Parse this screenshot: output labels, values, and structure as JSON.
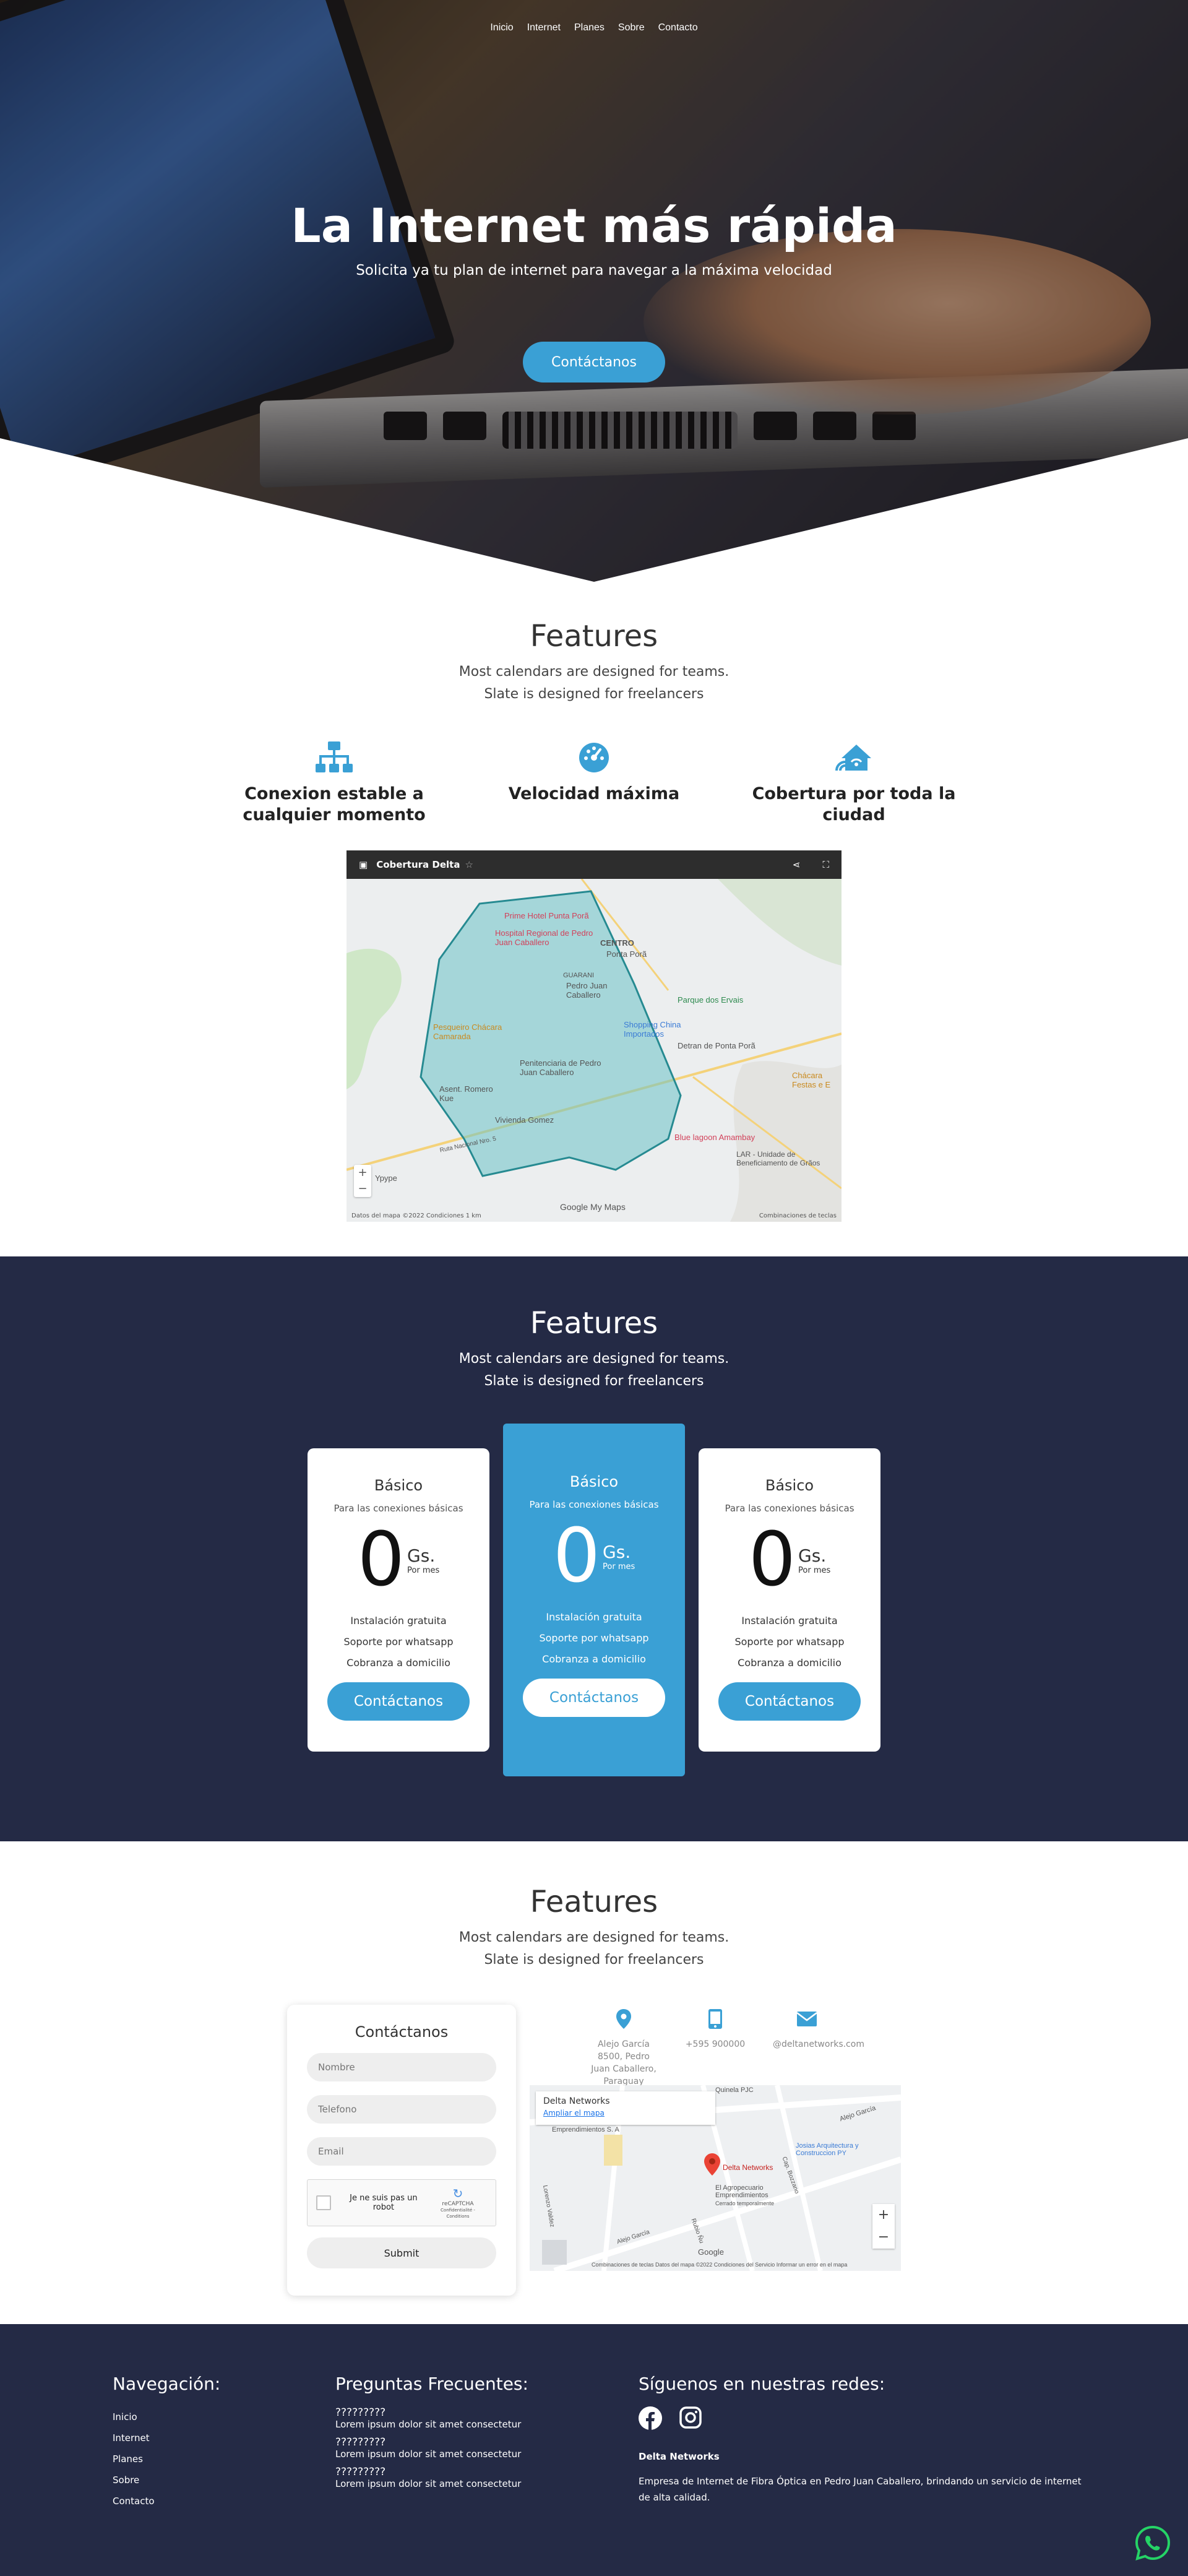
{
  "nav": {
    "items": [
      "Inicio",
      "Internet",
      "Planes",
      "Sobre",
      "Contacto"
    ]
  },
  "hero": {
    "title": "La Internet más rápida",
    "subtitle": "Solicita ya tu plan de internet para navegar a la máxima velocidad",
    "cta": "Contáctanos"
  },
  "features": {
    "title": "Features",
    "line1": "Most calendars are designed for teams.",
    "line2": "Slate is designed for freelancers",
    "items": [
      {
        "icon": "network-icon",
        "label": "Conexion estable a cualquier momento"
      },
      {
        "icon": "speedometer-icon",
        "label": "Velocidad máxima"
      },
      {
        "icon": "home-wifi-icon",
        "label": "Cobertura por toda la ciudad"
      }
    ],
    "map": {
      "title": "Cobertura Delta",
      "labels": [
        "Prime Hotel Punta Porã",
        "Hospital Regional de Pedro Juan Caballero",
        "CENTRO",
        "Ponta Porã",
        "GUARANI",
        "Pedro Juan Caballero",
        "Parque dos Ervais",
        "Shopping China Importados",
        "Detran de Ponta Porã",
        "Pesqueiro Chácara Camarada",
        "Penitenciaria de Pedro Juan Caballero",
        "Asent. Romero Kue",
        "Vivienda Gomez",
        "Blue lagoon Amambay",
        "LAR - Unidade de Beneficiamento de Grãos",
        "Chácara Festas e E",
        "Ruta Nacional Nro. 5",
        "Ypype"
      ],
      "brand": "Google My Maps",
      "footer_left": "Datos del mapa ©2022   Condiciones   1 km",
      "footer_right": "Combinaciones de teclas"
    }
  },
  "pricing": {
    "title": "Features",
    "line1": "Most calendars are designed for teams.",
    "line2": "Slate is designed for freelancers",
    "plans": [
      {
        "name": "Básico",
        "desc": "Para las conexiones básicas",
        "price": "0",
        "currency": "Gs.",
        "period": "Por mes",
        "features": [
          "Instalación gratuita",
          "Soporte por whatsapp",
          "Cobranza a domicilio"
        ],
        "cta": "Contáctanos"
      },
      {
        "name": "Básico",
        "desc": "Para las conexiones básicas",
        "price": "0",
        "currency": "Gs.",
        "period": "Por mes",
        "features": [
          "Instalación gratuita",
          "Soporte por whatsapp",
          "Cobranza a domicilio"
        ],
        "cta": "Contáctanos"
      },
      {
        "name": "Básico",
        "desc": "Para las conexiones básicas",
        "price": "0",
        "currency": "Gs.",
        "period": "Por mes",
        "features": [
          "Instalación gratuita",
          "Soporte por whatsapp",
          "Cobranza a domicilio"
        ],
        "cta": "Contáctanos"
      }
    ],
    "accent": "#3aa0d5"
  },
  "contact": {
    "title": "Features",
    "line1": "Most calendars are designed for teams.",
    "line2": "Slate is designed for freelancers",
    "form": {
      "title": "Contáctanos",
      "name_ph": "Nombre",
      "phone_ph": "Telefono",
      "email_ph": "Email",
      "captcha": "Je ne suis pas un robot",
      "captcha_brand": "reCAPTCHA",
      "captcha_links": "Confidentialité - Conditions",
      "submit": "Submit"
    },
    "info": {
      "address": "Alejo García 8500, Pedro Juan Caballero, Paraguay",
      "phone": "+595 900000",
      "email": "@deltanetworks.com"
    },
    "map": {
      "place": "Delta Networks",
      "enlarge": "Ampliar el mapa",
      "labels": [
        "Quinela PJC",
        "Emprendimientos S. A",
        "Alejo García",
        "Delta Networks",
        "Josias Arquitectura y Construccion PY",
        "El Agropecuario Emprendimientos",
        "Cerrado temporalmente",
        "Lorenzo Valdez",
        "Rubio Ñu",
        "Alejo García",
        "Cap. Bozzano"
      ],
      "footer": "Combinaciones de teclas   Datos del mapa ©2022   Condiciones del Servicio   Informar un error en el mapa"
    }
  },
  "footer": {
    "nav_title": "Navegación:",
    "nav_items": [
      "Inicio",
      "Internet",
      "Planes",
      "Sobre",
      "Contacto"
    ],
    "faq_title": "Preguntas Frecuentes:",
    "faq": [
      {
        "q": "?????????",
        "a": "Lorem ipsum dolor sit amet consectetur"
      },
      {
        "q": "?????????",
        "a": "Lorem ipsum dolor sit amet consectetur"
      },
      {
        "q": "?????????",
        "a": "Lorem ipsum dolor sit amet consectetur"
      }
    ],
    "social_title": "Síguenos en nuestras redes:",
    "brand": "Delta Networks",
    "desc": "Empresa de Internet de Fibra Óptica en Pedro Juan Caballero, brindando un servicio de internet de alta calidad."
  },
  "colors": {
    "dark": "#242a45",
    "accent": "#3aa0d5",
    "whatsapp": "#25d366"
  }
}
